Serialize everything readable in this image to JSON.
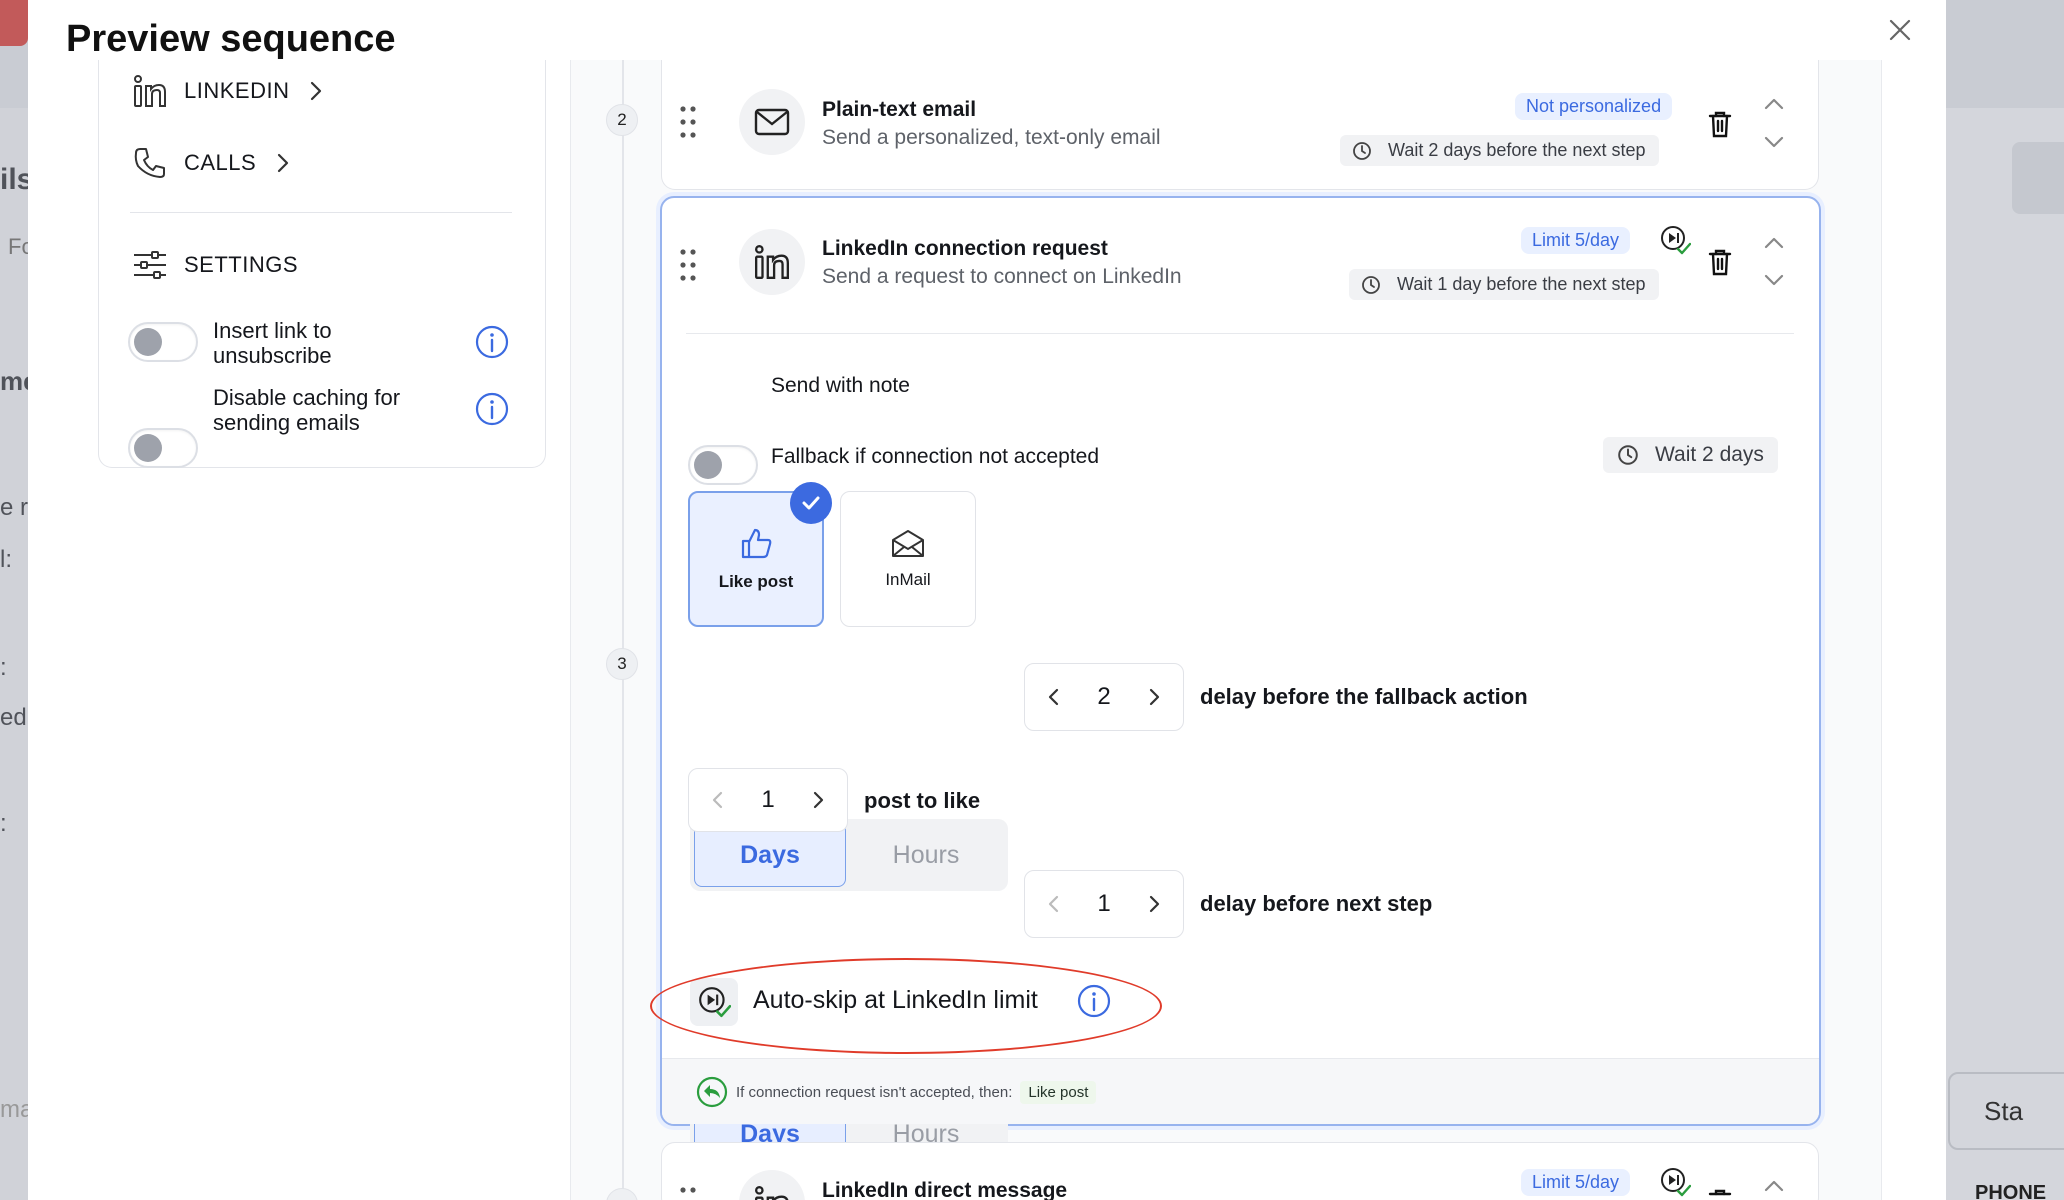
{
  "modal": {
    "title": "Preview sequence"
  },
  "background": {
    "left_fragments": [
      "ils",
      "Fo",
      "me",
      "e ra",
      "l:",
      ":",
      "ed",
      ":"
    ],
    "bottom_left_fragment": "ma",
    "bottom_right_button": "Sta",
    "bottom_right_header": "PHONE N"
  },
  "sidebar": {
    "items": [
      {
        "label": "LINKEDIN",
        "icon": "linkedin-icon"
      },
      {
        "label": "CALLS",
        "icon": "phone-icon"
      }
    ],
    "settings_label": "SETTINGS",
    "toggles": [
      {
        "label_line1": "Insert link to",
        "label_line2": "unsubscribe",
        "on": false
      },
      {
        "label_line1": "Disable caching for",
        "label_line2": "sending emails",
        "on": false
      }
    ]
  },
  "steps": [
    {
      "number": "2",
      "title": "Plain-text email",
      "subtitle": "Send a personalized, text-only email",
      "badge": "Not personalized",
      "wait": "Wait 2 days before the next step"
    },
    {
      "number": "3",
      "title": "LinkedIn connection request",
      "subtitle": "Send a request to connect on LinkedIn",
      "badge": "Limit 5/day",
      "wait": "Wait 1 day before the next step",
      "send_with_note": "Send with note",
      "fallback_label": "Fallback if connection not accepted",
      "fallback_wait": "Wait 2 days",
      "actions": [
        {
          "label": "Like post",
          "selected": true
        },
        {
          "label": "InMail",
          "selected": false
        }
      ],
      "fallback_delay": {
        "unit_on": "Days",
        "unit_off": "Hours",
        "value": "2",
        "label": "delay before the fallback action"
      },
      "posts_to_like": {
        "value": "1",
        "label": "post to like"
      },
      "next_delay": {
        "unit_on": "Days",
        "unit_off": "Hours",
        "value": "1",
        "label": "delay before next step"
      },
      "auto_skip": "Auto-skip at LinkedIn limit",
      "footer_text": "If connection request isn't accepted, then:",
      "footer_tag": "Like post"
    },
    {
      "title": "LinkedIn direct message",
      "badge": "Limit 5/day"
    }
  ],
  "colors": {
    "accent": "#3b6ae0",
    "annotation": "#e03b2a"
  }
}
